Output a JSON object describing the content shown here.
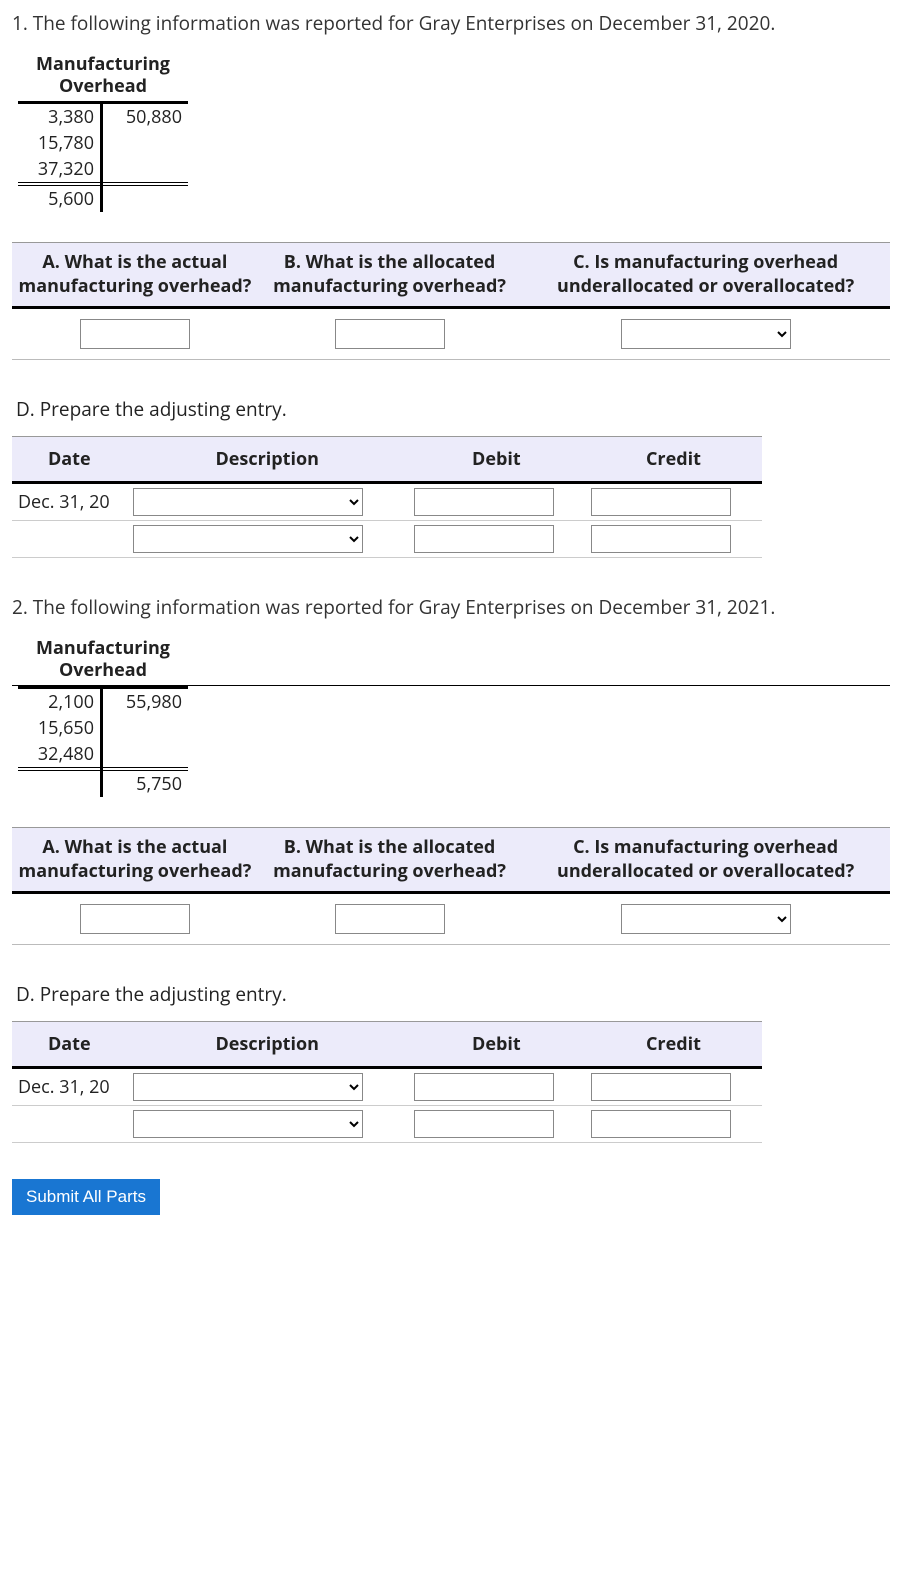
{
  "q1": {
    "intro": "1. The following information was reported for Gray Enterprises on December 31, 2020.",
    "t_title": "Manufacturing Overhead",
    "t_left": [
      "3,380",
      "15,780",
      "37,320"
    ],
    "t_left_total": "5,600",
    "t_right": [
      "50,880"
    ],
    "t_right_total": ""
  },
  "abc_headers": {
    "a": "A. What is the actual manufacturing overhead?",
    "b": "B. What is the allocated manufacturing overhead?",
    "c": "C. Is manufacturing overhead underallocated or overallocated?"
  },
  "d_label": "D. Prepare the adjusting entry.",
  "journal_headers": {
    "date": "Date",
    "desc": "Description",
    "debit": "Debit",
    "credit": "Credit"
  },
  "journal_date": "Dec. 31, 20",
  "q2": {
    "intro": "2. The following information was reported for Gray Enterprises on December 31, 2021.",
    "t_title": "Manufacturing Overhead",
    "t_left": [
      "2,100",
      "15,650",
      "32,480"
    ],
    "t_left_total": "",
    "t_right": [
      "55,980"
    ],
    "t_right_total": "5,750"
  },
  "submit_label": "Submit All Parts"
}
